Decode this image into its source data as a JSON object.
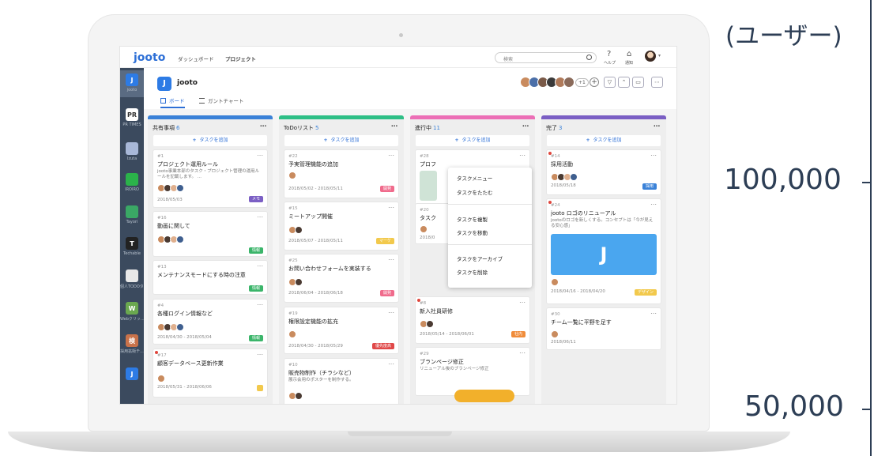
{
  "axis": {
    "unit": "(ユーザー)",
    "ticks": [
      "100,000",
      "50,000"
    ]
  },
  "topbar": {
    "logo": "jooto",
    "nav": [
      "ダッシュボード",
      "プロジェクト"
    ],
    "search_placeholder": "検索",
    "help_label": "ヘルプ",
    "notify_label": "通知",
    "help_icon": "question-icon",
    "notify_icon": "bell-icon"
  },
  "sidebar": {
    "items": [
      {
        "label": "jooto",
        "icon_text": "J",
        "color": "#2d7be5"
      },
      {
        "label": "PR TIMES",
        "icon_text": "PR",
        "color": "#ffffff"
      },
      {
        "label": "Izuta",
        "icon_text": "",
        "color": "#a8b8d8"
      },
      {
        "label": "IROIRO",
        "icon_text": "",
        "color": "#2bb34a"
      },
      {
        "label": "Tayori",
        "icon_text": "",
        "color": "#3aa865"
      },
      {
        "label": "Techable",
        "icon_text": "T",
        "color": "#222222"
      },
      {
        "label": "個人TODOタ...",
        "icon_text": "",
        "color": "#e8e8e8"
      },
      {
        "label": "Webクリッ...",
        "icon_text": "W",
        "color": "#6aa84f"
      },
      {
        "label": "採用拡販チ...",
        "icon_text": "検",
        "color": "#c9724a"
      },
      {
        "label": "",
        "icon_text": "J",
        "color": "#2d7be5"
      }
    ]
  },
  "project": {
    "name": "jooto",
    "tabs": [
      "ボード",
      "ガントチャート"
    ],
    "member_more": "+1",
    "member_add": "+"
  },
  "columns": [
    {
      "name": "共有事項",
      "count": "6",
      "color": "#3b82d8",
      "add_label": "タスクを追加",
      "cards": [
        {
          "num": "#1",
          "title": "プロジェクト運用ルール",
          "desc": "jooto事業本部のタスク・プロジェクト管理の運用ルールを記載します。 ...",
          "date": "2018/05/03",
          "tag": "メモ",
          "tag_color": "#7b5fc4",
          "avatars": 4,
          "red_dot": false
        },
        {
          "num": "#16",
          "title": "動画に関して",
          "desc": "",
          "date": "",
          "tag": "情報",
          "tag_color": "#3bb56a",
          "avatars": 4,
          "red_dot": false
        },
        {
          "num": "#13",
          "title": "メンテナンスモードにする時の注意",
          "desc": "",
          "date": "",
          "tag": "情報",
          "tag_color": "#3bb56a",
          "avatars": 0,
          "red_dot": false
        },
        {
          "num": "#4",
          "title": "各種ログイン情報など",
          "desc": "",
          "date": "2018/04/30 - 2018/05/04",
          "tag": "情報",
          "tag_color": "#3bb56a",
          "avatars": 4,
          "red_dot": false
        },
        {
          "num": "#17",
          "title": "顧客データベース更新作業",
          "desc": "",
          "date": "2018/05/31 - 2018/06/06",
          "tag": "",
          "tag_color": "#f2c94c",
          "avatars": 1,
          "red_dot": true
        }
      ]
    },
    {
      "name": "ToDoリスト",
      "count": "5",
      "color": "#2ebf86",
      "add_label": "タスクを追加",
      "cards": [
        {
          "num": "#22",
          "title": "予実管理機能の追加",
          "desc": "",
          "date": "2018/05/02 - 2018/05/11",
          "tag": "開発",
          "tag_color": "#f06b8c",
          "avatars": 1,
          "red_dot": false
        },
        {
          "num": "#15",
          "title": "ミートアップ開催",
          "desc": "",
          "date": "2018/05/07 - 2018/05/11",
          "tag": "マーケ",
          "tag_color": "#f2c94c",
          "avatars": 2,
          "red_dot": false
        },
        {
          "num": "#25",
          "title": "お問い合わせフォームを実装する",
          "desc": "",
          "date": "2018/06/04 - 2018/06/18",
          "tag": "開発",
          "tag_color": "#f06b8c",
          "avatars": 2,
          "red_dot": false
        },
        {
          "num": "#19",
          "title": "権限設定機能の拡充",
          "desc": "",
          "date": "2018/04/30 - 2018/05/29",
          "tag": "優先度高",
          "tag_color": "#e04848",
          "avatars": 1,
          "red_dot": false
        },
        {
          "num": "#10",
          "title": "販売物制作（チラシなど）",
          "desc": "展示会用のポスターを制作する。",
          "date": "",
          "tag": "",
          "tag_color": "",
          "avatars": 2,
          "red_dot": false
        }
      ]
    },
    {
      "name": "進行中",
      "count": "11",
      "color": "#ec6fb6",
      "add_label": "タスクを追加",
      "cards": [
        {
          "num": "#28",
          "title": "プロフ",
          "desc": "",
          "date": "",
          "tag": "",
          "tag_color": "",
          "avatars": 0,
          "red_dot": false
        },
        {
          "num": "#20",
          "title": "タスク",
          "desc": "",
          "date": "2018/0",
          "tag": "",
          "tag_color": "",
          "avatars": 1,
          "red_dot": false
        },
        {
          "num": "#8",
          "title": "新入社員研修",
          "desc": "",
          "date": "2018/05/14 - 2018/06/01",
          "tag": "社内",
          "tag_color": "#f08c3a",
          "avatars": 2,
          "red_dot": true
        },
        {
          "num": "#29",
          "title": "ブランページ修正",
          "desc": "リニューアル後のブランページ修正",
          "date": "",
          "tag": "",
          "tag_color": "",
          "avatars": 0,
          "red_dot": false
        }
      ]
    },
    {
      "name": "完了",
      "count": "3",
      "color": "#7b5fc4",
      "add_label": "タスクを追加",
      "cards": [
        {
          "num": "#14",
          "title": "採用活動",
          "desc": "",
          "date": "2018/05/18",
          "tag": "採用",
          "tag_color": "#3b82d8",
          "avatars": 4,
          "red_dot": true
        },
        {
          "num": "#24",
          "title": "jooto ロゴのリニューアル",
          "desc": "jootoのロゴを新しくする。コンセプトは「今が見える安心感」",
          "date": "2018/04/16 - 2018/04/20",
          "tag": "デザイン",
          "tag_color": "#f2c94c",
          "avatars": 1,
          "red_dot": true
        },
        {
          "num": "#30",
          "title": "チーム一覧に平野を足す",
          "desc": "",
          "date": "2018/06/11",
          "tag": "",
          "tag_color": "",
          "avatars": 1,
          "red_dot": false
        }
      ]
    }
  ],
  "context_menu": {
    "title": "タスクメニュー",
    "items": [
      "タスクをたたむ",
      "タスクを複製",
      "タスクを移動",
      "タスクをアーカイブ",
      "タスクを削除"
    ]
  }
}
